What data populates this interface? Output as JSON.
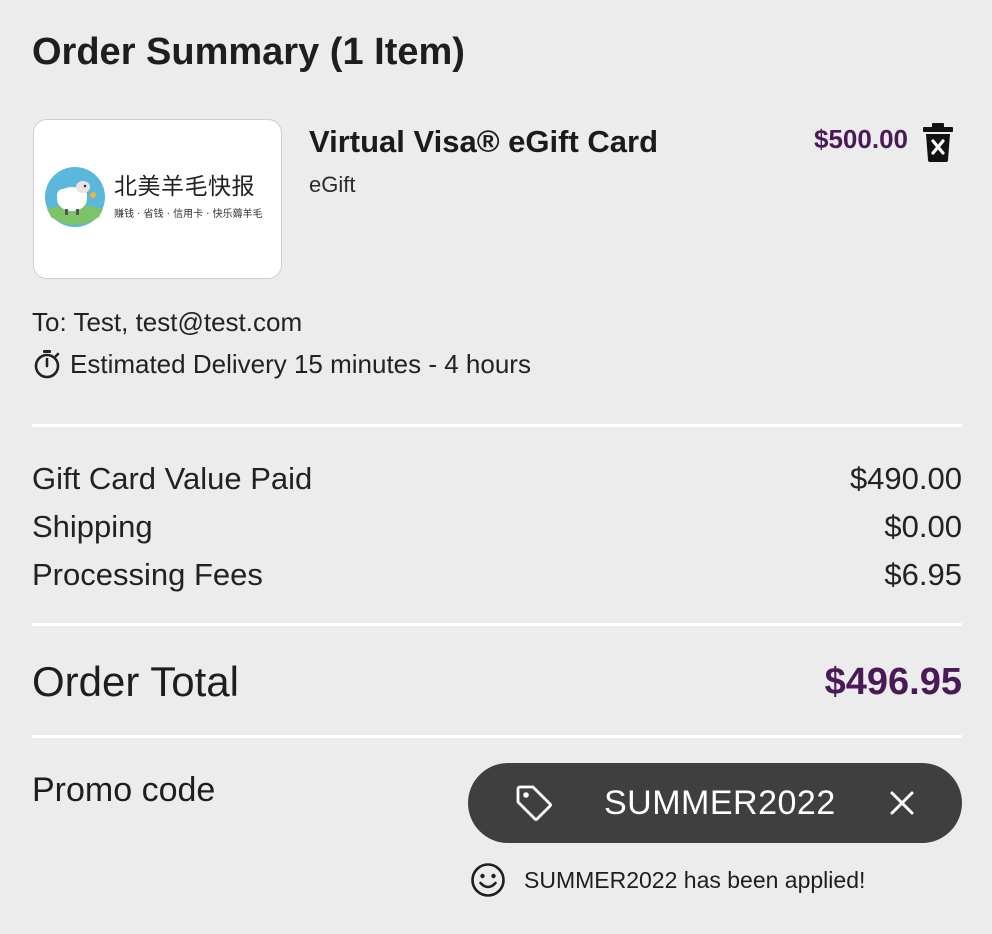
{
  "summary": {
    "title": "Order Summary (1 Item)"
  },
  "item": {
    "thumbnail": {
      "logo_name": "北美羊毛快报",
      "logo_tagline": "赚钱 · 省钱 · 信用卡 · 快乐薅羊毛",
      "icon": "sheep-logo-icon"
    },
    "name": "Virtual Visa® eGift Card",
    "type": "eGift",
    "price": "$500.00",
    "remove_icon": "trash-icon",
    "recipient": "To: Test, test@test.com",
    "delivery_icon": "stopwatch-icon",
    "delivery": "Estimated Delivery 15 minutes - 4 hours"
  },
  "line_items": [
    {
      "label": "Gift Card Value Paid",
      "value": "$490.00"
    },
    {
      "label": "Shipping",
      "value": "$0.00"
    },
    {
      "label": "Processing Fees",
      "value": "$6.95"
    }
  ],
  "total": {
    "label": "Order Total",
    "value": "$496.95"
  },
  "promo": {
    "label": "Promo code",
    "code": "SUMMER2022",
    "tag_icon": "tag-icon",
    "remove_icon": "close-icon",
    "status_icon": "smile-icon",
    "status_message": "SUMMER2022 has been applied!"
  },
  "colors": {
    "background": "#ececec",
    "accent_purple": "#4a1a58",
    "pill": "#3f3f3f",
    "divider": "#ffffff"
  }
}
